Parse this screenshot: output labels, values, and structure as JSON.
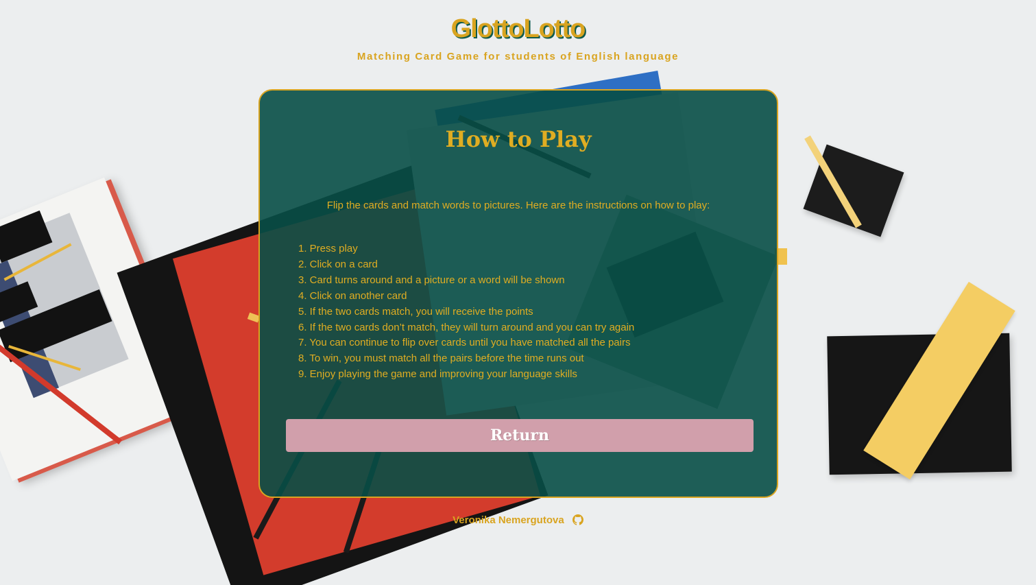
{
  "header": {
    "title": "GlottoLotto",
    "subtitle": "Matching Card Game for students of English language"
  },
  "panel": {
    "title": "How to Play",
    "intro": "Flip the cards and match words to pictures. Here are the instructions on how to play:",
    "steps": [
      "1. Press play",
      "2. Click on a card",
      "3. Card turns around and a picture or a word will be shown",
      "4. Click on another card",
      "5. If the two cards match, you will receive the points",
      "6. If the two cards don’t match, they will turn around and you can try again",
      "7. You can continue to flip over cards until you have matched all the pairs",
      "8. To win, you must match all the pairs before the time runs out",
      "9. Enjoy playing the game and improving your language skills"
    ],
    "return_label": "Return"
  },
  "footer": {
    "author": "Veronika Nemergutova",
    "icon": "github-icon"
  },
  "colors": {
    "accent": "#d9a420",
    "panel_bg": "#084e46",
    "button_bg": "#d19fab"
  }
}
